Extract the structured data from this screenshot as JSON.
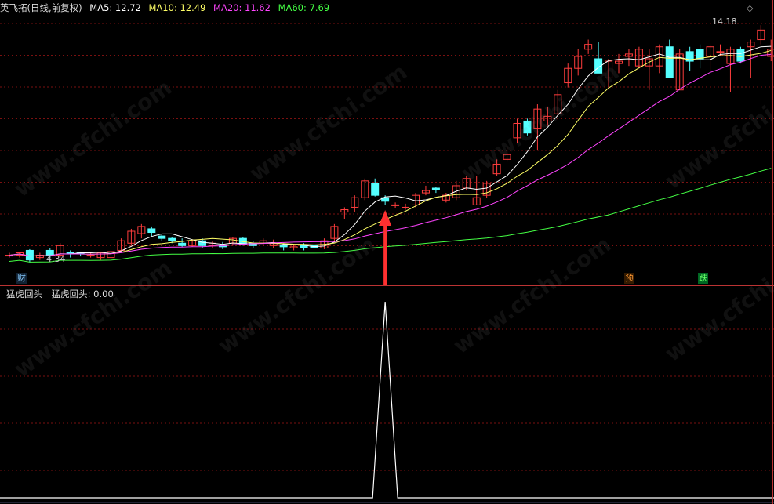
{
  "main": {
    "title_prefix": "英飞拓(日线,前复权)",
    "ma": [
      {
        "label": "MA5: 12.72",
        "color": "#ffffff"
      },
      {
        "label": "MA10: 12.49",
        "color": "#ffff66"
      },
      {
        "label": "MA20: 11.62",
        "color": "#ff44ff"
      },
      {
        "label": "MA60: 7.69",
        "color": "#44ff44"
      }
    ],
    "high_label": "14.18",
    "low_label": "4.34",
    "badges": {
      "cai": "财",
      "yu": "预",
      "die": "跌"
    }
  },
  "sub": {
    "title": "猛虎回头",
    "value_label": "猛虎回头: 0.00"
  },
  "watermark": "www.cfchi.com",
  "colors": {
    "up": "#ff3d3d",
    "down": "#54ffff",
    "grid": "#7a1010",
    "arrow": "#ff3030"
  },
  "price_range": [
    3.8,
    14.6
  ],
  "chart_data": {
    "type": "candlestick",
    "candles": [
      [
        4.6,
        4.7,
        4.5,
        4.6
      ],
      [
        4.6,
        4.75,
        4.5,
        4.7
      ],
      [
        4.8,
        4.85,
        4.3,
        4.4
      ],
      [
        4.5,
        4.7,
        4.4,
        4.6
      ],
      [
        4.8,
        4.9,
        4.5,
        4.6
      ],
      [
        4.6,
        5.1,
        4.5,
        5.0
      ],
      [
        4.7,
        4.8,
        4.5,
        4.65
      ],
      [
        4.7,
        4.75,
        4.55,
        4.65
      ],
      [
        4.6,
        4.7,
        4.5,
        4.6
      ],
      [
        4.5,
        4.75,
        4.4,
        4.7
      ],
      [
        4.5,
        4.8,
        4.45,
        4.75
      ],
      [
        4.8,
        5.3,
        4.7,
        5.2
      ],
      [
        5.1,
        5.7,
        5.0,
        5.6
      ],
      [
        5.5,
        5.9,
        5.3,
        5.8
      ],
      [
        5.7,
        5.8,
        5.4,
        5.55
      ],
      [
        5.4,
        5.5,
        5.2,
        5.3
      ],
      [
        5.3,
        5.35,
        5.1,
        5.2
      ],
      [
        5.1,
        5.3,
        4.95,
        5.0
      ],
      [
        5.0,
        5.25,
        4.95,
        5.2
      ],
      [
        5.2,
        5.3,
        4.9,
        5.0
      ],
      [
        5.0,
        5.2,
        4.9,
        5.1
      ],
      [
        5.0,
        5.15,
        4.85,
        4.95
      ],
      [
        5.1,
        5.35,
        5.0,
        5.3
      ],
      [
        5.3,
        5.35,
        5.0,
        5.05
      ],
      [
        5.1,
        5.2,
        4.9,
        5.0
      ],
      [
        5.1,
        5.3,
        5.0,
        5.2
      ],
      [
        5.0,
        5.25,
        4.9,
        5.1
      ],
      [
        5.0,
        5.1,
        4.8,
        4.95
      ],
      [
        4.9,
        5.05,
        4.8,
        4.95
      ],
      [
        5.0,
        5.1,
        4.8,
        4.9
      ],
      [
        5.0,
        5.1,
        4.85,
        4.9
      ],
      [
        4.9,
        5.3,
        4.85,
        5.2
      ],
      [
        5.3,
        5.9,
        5.2,
        5.8
      ],
      [
        6.4,
        6.6,
        6.1,
        6.5
      ],
      [
        6.6,
        7.1,
        6.4,
        7.0
      ],
      [
        7.0,
        7.8,
        6.9,
        7.7
      ],
      [
        7.6,
        7.8,
        7.05,
        7.1
      ],
      [
        7.0,
        7.1,
        6.7,
        6.85
      ],
      [
        6.7,
        6.8,
        6.55,
        6.7
      ],
      [
        6.6,
        6.75,
        6.5,
        6.6
      ],
      [
        6.7,
        7.2,
        6.6,
        7.1
      ],
      [
        7.2,
        7.5,
        7.1,
        7.3
      ],
      [
        7.4,
        7.45,
        7.2,
        7.35
      ],
      [
        6.9,
        7.2,
        6.8,
        7.1
      ],
      [
        7.0,
        7.7,
        6.9,
        7.5
      ],
      [
        7.4,
        7.9,
        7.3,
        7.8
      ],
      [
        6.7,
        7.9,
        6.7,
        7.0
      ],
      [
        7.1,
        7.7,
        7.0,
        7.6
      ],
      [
        8.0,
        8.6,
        7.9,
        8.4
      ],
      [
        8.6,
        9.1,
        8.5,
        8.8
      ],
      [
        9.5,
        10.3,
        9.3,
        10.1
      ],
      [
        10.2,
        10.3,
        9.6,
        9.7
      ],
      [
        9.9,
        10.9,
        9.0,
        10.7
      ],
      [
        10.2,
        10.8,
        10.0,
        10.4
      ],
      [
        10.5,
        11.5,
        10.4,
        11.3
      ],
      [
        11.8,
        12.6,
        11.6,
        12.4
      ],
      [
        12.4,
        13.2,
        12.1,
        12.9
      ],
      [
        13.2,
        13.6,
        13.0,
        13.4
      ],
      [
        12.8,
        13.5,
        12.6,
        12.2
      ],
      [
        12.0,
        12.8,
        11.6,
        12.7
      ],
      [
        12.6,
        13.0,
        12.2,
        12.7
      ],
      [
        12.9,
        13.2,
        12.5,
        13.0
      ],
      [
        12.5,
        13.3,
        12.4,
        13.2
      ],
      [
        12.5,
        13.2,
        11.5,
        12.8
      ],
      [
        12.5,
        13.4,
        12.2,
        13.3
      ],
      [
        13.3,
        13.6,
        12.0,
        12.0
      ],
      [
        11.5,
        13.2,
        11.5,
        13.0
      ],
      [
        13.1,
        13.3,
        12.3,
        12.7
      ],
      [
        13.2,
        13.4,
        12.4,
        12.8
      ],
      [
        12.9,
        13.4,
        12.3,
        13.3
      ],
      [
        13.1,
        13.4,
        12.9,
        13.1
      ],
      [
        12.6,
        13.3,
        11.4,
        13.2
      ],
      [
        13.2,
        13.3,
        12.6,
        12.7
      ],
      [
        13.3,
        13.6,
        12.0,
        13.5
      ],
      [
        13.6,
        14.2,
        13.4,
        14.0
      ],
      [
        12.9,
        13.6,
        12.7,
        13.2
      ]
    ],
    "signal_index": 37,
    "signal_value": 1
  }
}
